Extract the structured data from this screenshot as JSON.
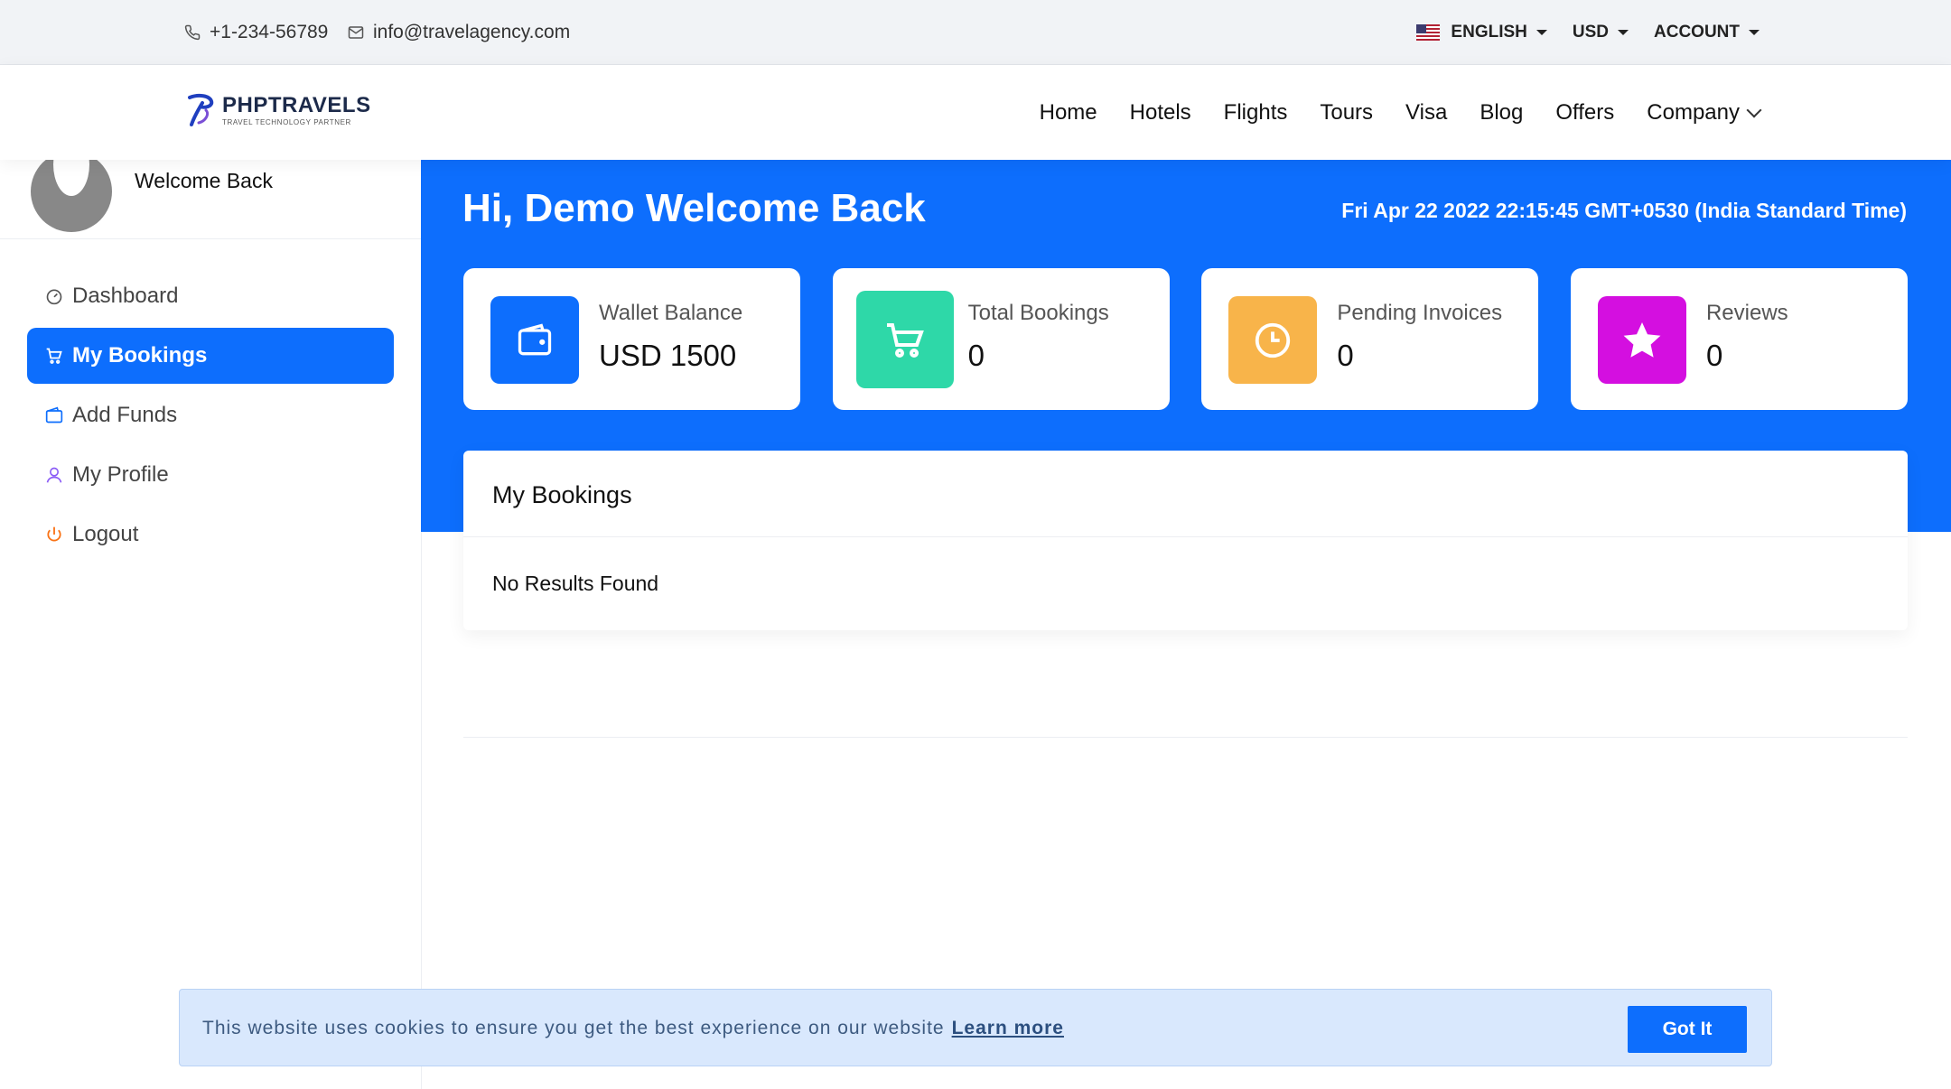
{
  "topbar": {
    "phone": "+1-234-56789",
    "email": "info@travelagency.com",
    "language": "ENGLISH",
    "currency": "USD",
    "account": "ACCOUNT"
  },
  "header": {
    "logo_title": "PHPTRAVELS",
    "logo_subtitle": "TRAVEL TECHNOLOGY PARTNER",
    "nav": [
      "Home",
      "Hotels",
      "Flights",
      "Tours",
      "Visa",
      "Blog",
      "Offers",
      "Company"
    ]
  },
  "sidebar": {
    "welcome": "Welcome Back",
    "items": [
      {
        "label": "Dashboard",
        "icon": "dashboard-icon"
      },
      {
        "label": "My Bookings",
        "icon": "cart-icon",
        "active": true
      },
      {
        "label": "Add Funds",
        "icon": "wallet-icon"
      },
      {
        "label": "My Profile",
        "icon": "user-icon"
      },
      {
        "label": "Logout",
        "icon": "power-icon"
      }
    ]
  },
  "main": {
    "greeting": "Hi, Demo Welcome Back",
    "datetime": "Fri Apr 22 2022 22:15:45 GMT+0530 (India Standard Time)",
    "cards": [
      {
        "label": "Wallet Balance",
        "value": "USD 1500",
        "icon": "wallet-icon",
        "color": "#0d6efd"
      },
      {
        "label": "Total Bookings",
        "value": "0",
        "icon": "cart-icon",
        "color": "#2ed8a8"
      },
      {
        "label": "Pending Invoices",
        "value": "0",
        "icon": "clock-icon",
        "color": "#f8b44a"
      },
      {
        "label": "Reviews",
        "value": "0",
        "icon": "star-icon",
        "color": "#d40fe0"
      }
    ],
    "bookings": {
      "title": "My Bookings",
      "empty": "No Results Found"
    }
  },
  "cookie": {
    "text": "This website uses cookies to ensure you get the best experience on our website",
    "link": "Learn more",
    "button": "Got It"
  },
  "colors": {
    "primary": "#0d6efd",
    "topbar_bg": "#f1f3f6",
    "cookie_bg": "#d9e8fd"
  }
}
